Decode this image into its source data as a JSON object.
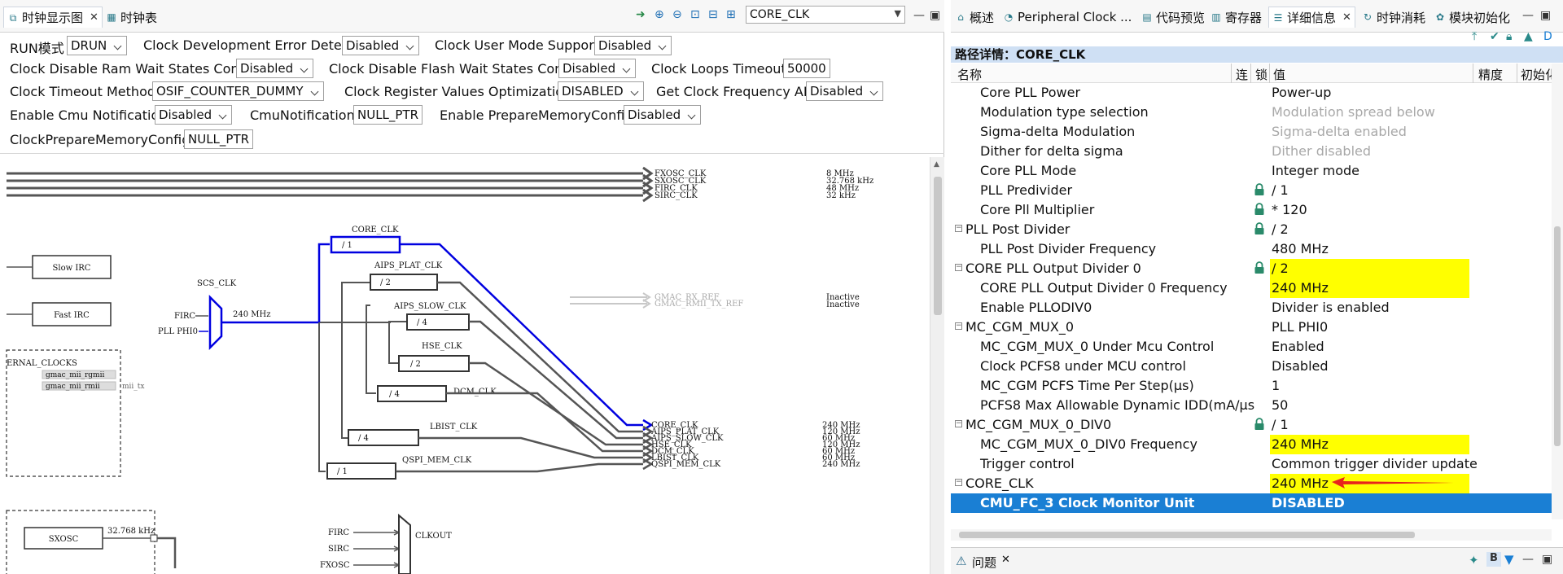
{
  "left_tabs": {
    "diagram": "时钟显示图",
    "table": "时钟表"
  },
  "search": {
    "value": "CORE_CLK"
  },
  "config": [
    {
      "label": "RUN模式",
      "value": "DRUN",
      "type": "dropdown"
    },
    {
      "label": "Clock Development Error Detect",
      "value": "Disabled",
      "type": "dropdown"
    },
    {
      "label": "Clock User Mode Support",
      "value": "Disabled",
      "type": "dropdown"
    },
    {
      "label": "Clock Disable Ram Wait States Config",
      "value": "Disabled",
      "type": "dropdown"
    },
    {
      "label": "Clock Disable Flash Wait States Config",
      "value": "Disabled",
      "type": "dropdown"
    },
    {
      "label": "Clock Loops Timeout",
      "value": "50000",
      "type": "text"
    },
    {
      "label": "Clock Timeout Method",
      "value": "OSIF_COUNTER_DUMMY",
      "type": "dropdown"
    },
    {
      "label": "Clock Register Values Optimization",
      "value": "DISABLED",
      "type": "dropdown"
    },
    {
      "label": "Get Clock Frequency API",
      "value": "Disabled",
      "type": "dropdown"
    },
    {
      "label": "Enable Cmu Notification",
      "value": "Disabled",
      "type": "dropdown"
    },
    {
      "label": "CmuNotification",
      "value": "NULL_PTR",
      "type": "text"
    },
    {
      "label": "Enable PrepareMemoryConfig",
      "value": "Disabled",
      "type": "dropdown"
    },
    {
      "label": "ClockPrepareMemoryConfig",
      "value": "NULL_PTR",
      "type": "text"
    }
  ],
  "diagram": {
    "top_clocks": [
      "FXOSC_CLK",
      "SXOSC_CLK",
      "FIRC_CLK",
      "SIRC_CLK"
    ],
    "top_freqs": [
      "8 MHz",
      "32.768 kHz",
      "48 MHz",
      "32 kHz"
    ],
    "slow_irc": "Slow IRC",
    "fast_irc": "Fast IRC",
    "scs_clk": "SCS_CLK",
    "firc": "FIRC",
    "pll_phi0": "PLL PHI0",
    "scs_freq": "240 MHz",
    "ext_clocks": "ERNAL_CLOCKS",
    "gmac_rgmii": "gmac_mii_rgmii",
    "gmac_rmii": "gmac_mii_rmii",
    "mii_tx": "mii_tx",
    "dividers": [
      {
        "name": "CORE_CLK",
        "div": "/ 1"
      },
      {
        "name": "AIPS_PLAT_CLK",
        "div": "/ 2"
      },
      {
        "name": "AIPS_SLOW_CLK",
        "div": "/ 4"
      },
      {
        "name": "HSE_CLK",
        "div": "/ 2"
      },
      {
        "name": "DCM_CLK",
        "div": "/ 4"
      },
      {
        "name": "LBIST_CLK",
        "div": "/ 4"
      },
      {
        "name": "QSPI_MEM_CLK",
        "div": "/ 1"
      }
    ],
    "outputs": [
      "CORE_CLK",
      "AIPS_PLAT_CLK",
      "AIPS_SLOW_CLK",
      "HSE_CLK",
      "DCM_CLK",
      "LBIST_CLK",
      "QSPI_MEM_CLK"
    ],
    "output_freqs": [
      "240 MHz",
      "120 MHz",
      "60 MHz",
      "120 MHz",
      "60 MHz",
      "60 MHz",
      "240 MHz"
    ],
    "gmac": [
      "GMAC_RX_REF",
      "GMAC_RMII_TX_REF"
    ],
    "gmac_status": [
      "Inactive",
      "Inactive"
    ],
    "sxosc": "SXOSC",
    "sxosc_freq": "32.768 kHz",
    "clkout": "CLKOUT",
    "clkout_inputs": [
      "FIRC",
      "SIRC",
      "FXOSC"
    ]
  },
  "right_tabs": [
    "概述",
    "Peripheral Clock ...",
    "代码预览",
    "寄存器",
    "详细信息",
    "时钟消耗",
    "模块初始化"
  ],
  "path": {
    "label": "路径详情：",
    "value": "CORE_CLK"
  },
  "columns": {
    "name": "名称",
    "conn": "连",
    "lock": "锁",
    "value": "值",
    "precision": "精度",
    "init": "初始化"
  },
  "details": [
    {
      "name": "Core PLL Power",
      "value": "Power-up",
      "indent": 1
    },
    {
      "name": "Modulation type selection",
      "value": "Modulation spread below",
      "indent": 1,
      "dim": true
    },
    {
      "name": "Sigma-delta Modulation",
      "value": "Sigma-delta enabled",
      "indent": 1,
      "dim": true
    },
    {
      "name": "Dither for delta sigma",
      "value": "Dither disabled",
      "indent": 1,
      "dim": true
    },
    {
      "name": "Core PLL Mode",
      "value": "Integer mode",
      "indent": 1
    },
    {
      "name": "PLL Predivider",
      "value": "/ 1",
      "indent": 1,
      "lock": true
    },
    {
      "name": "Core Pll Multiplier",
      "value": "* 120",
      "indent": 1,
      "lock": true
    },
    {
      "name": "PLL Post Divider",
      "value": "/ 2",
      "indent": 0,
      "lock": true,
      "group": true
    },
    {
      "name": "PLL Post Divider Frequency",
      "value": "480 MHz",
      "indent": 1
    },
    {
      "name": "CORE PLL Output Divider 0",
      "value": "/ 2",
      "indent": 0,
      "lock": true,
      "group": true,
      "hl": true
    },
    {
      "name": "CORE PLL Output Divider 0 Frequency",
      "value": "240 MHz",
      "indent": 1,
      "hl": true
    },
    {
      "name": "Enable PLLODIV0",
      "value": "Divider is enabled",
      "indent": 1
    },
    {
      "name": "MC_CGM_MUX_0",
      "value": "PLL PHI0",
      "indent": 0,
      "group": true
    },
    {
      "name": "MC_CGM_MUX_0 Under Mcu Control",
      "value": "Enabled",
      "indent": 1
    },
    {
      "name": "Clock PCFS8 under MCU control",
      "value": "Disabled",
      "indent": 1
    },
    {
      "name": "MC_CGM PCFS Time Per Step(μs)",
      "value": "1",
      "indent": 1
    },
    {
      "name": "PCFS8 Max Allowable Dynamic IDD(mA/μs",
      "value": "50",
      "indent": 1
    },
    {
      "name": "MC_CGM_MUX_0_DIV0",
      "value": "/ 1",
      "indent": 0,
      "lock": true,
      "group": true
    },
    {
      "name": "MC_CGM_MUX_0_DIV0 Frequency",
      "value": "240 MHz",
      "indent": 1,
      "hl": true
    },
    {
      "name": "Trigger control",
      "value": "Common trigger divider update",
      "indent": 1
    },
    {
      "name": "CORE_CLK",
      "value": "240 MHz",
      "indent": 0,
      "group": true,
      "hl": true,
      "arrow": true
    },
    {
      "name": "CMU_FC_3 Clock Monitor Unit",
      "value": "DISABLED",
      "indent": 1,
      "selected": true
    }
  ],
  "bottom": {
    "problems": "问题"
  },
  "colors": {
    "accent": "#1a7fd4",
    "highlight": "#ffff00",
    "arrow": "#e8241c",
    "wire_active": "#0000e0"
  }
}
